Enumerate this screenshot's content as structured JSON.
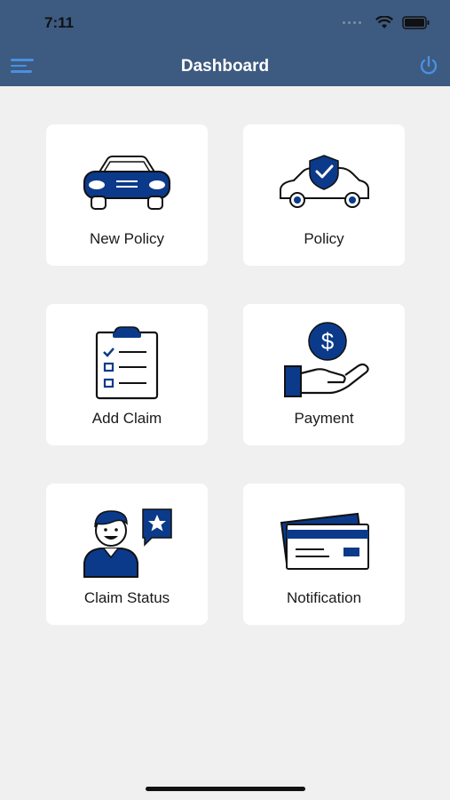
{
  "status_bar": {
    "time": "7:11"
  },
  "header": {
    "title": "Dashboard"
  },
  "tiles": [
    {
      "label": "New Policy",
      "icon": "car-front-icon"
    },
    {
      "label": "Policy",
      "icon": "car-shield-icon"
    },
    {
      "label": "Add Claim",
      "icon": "clipboard-checklist-icon"
    },
    {
      "label": "Payment",
      "icon": "hand-coin-icon"
    },
    {
      "label": "Claim Status",
      "icon": "person-feedback-icon"
    },
    {
      "label": "Notification",
      "icon": "cards-icon"
    }
  ],
  "colors": {
    "header_bg": "#3d5a80",
    "accent": "#0b3a8a",
    "icon_blue": "#4a90e2",
    "background": "#f0f0f0"
  }
}
